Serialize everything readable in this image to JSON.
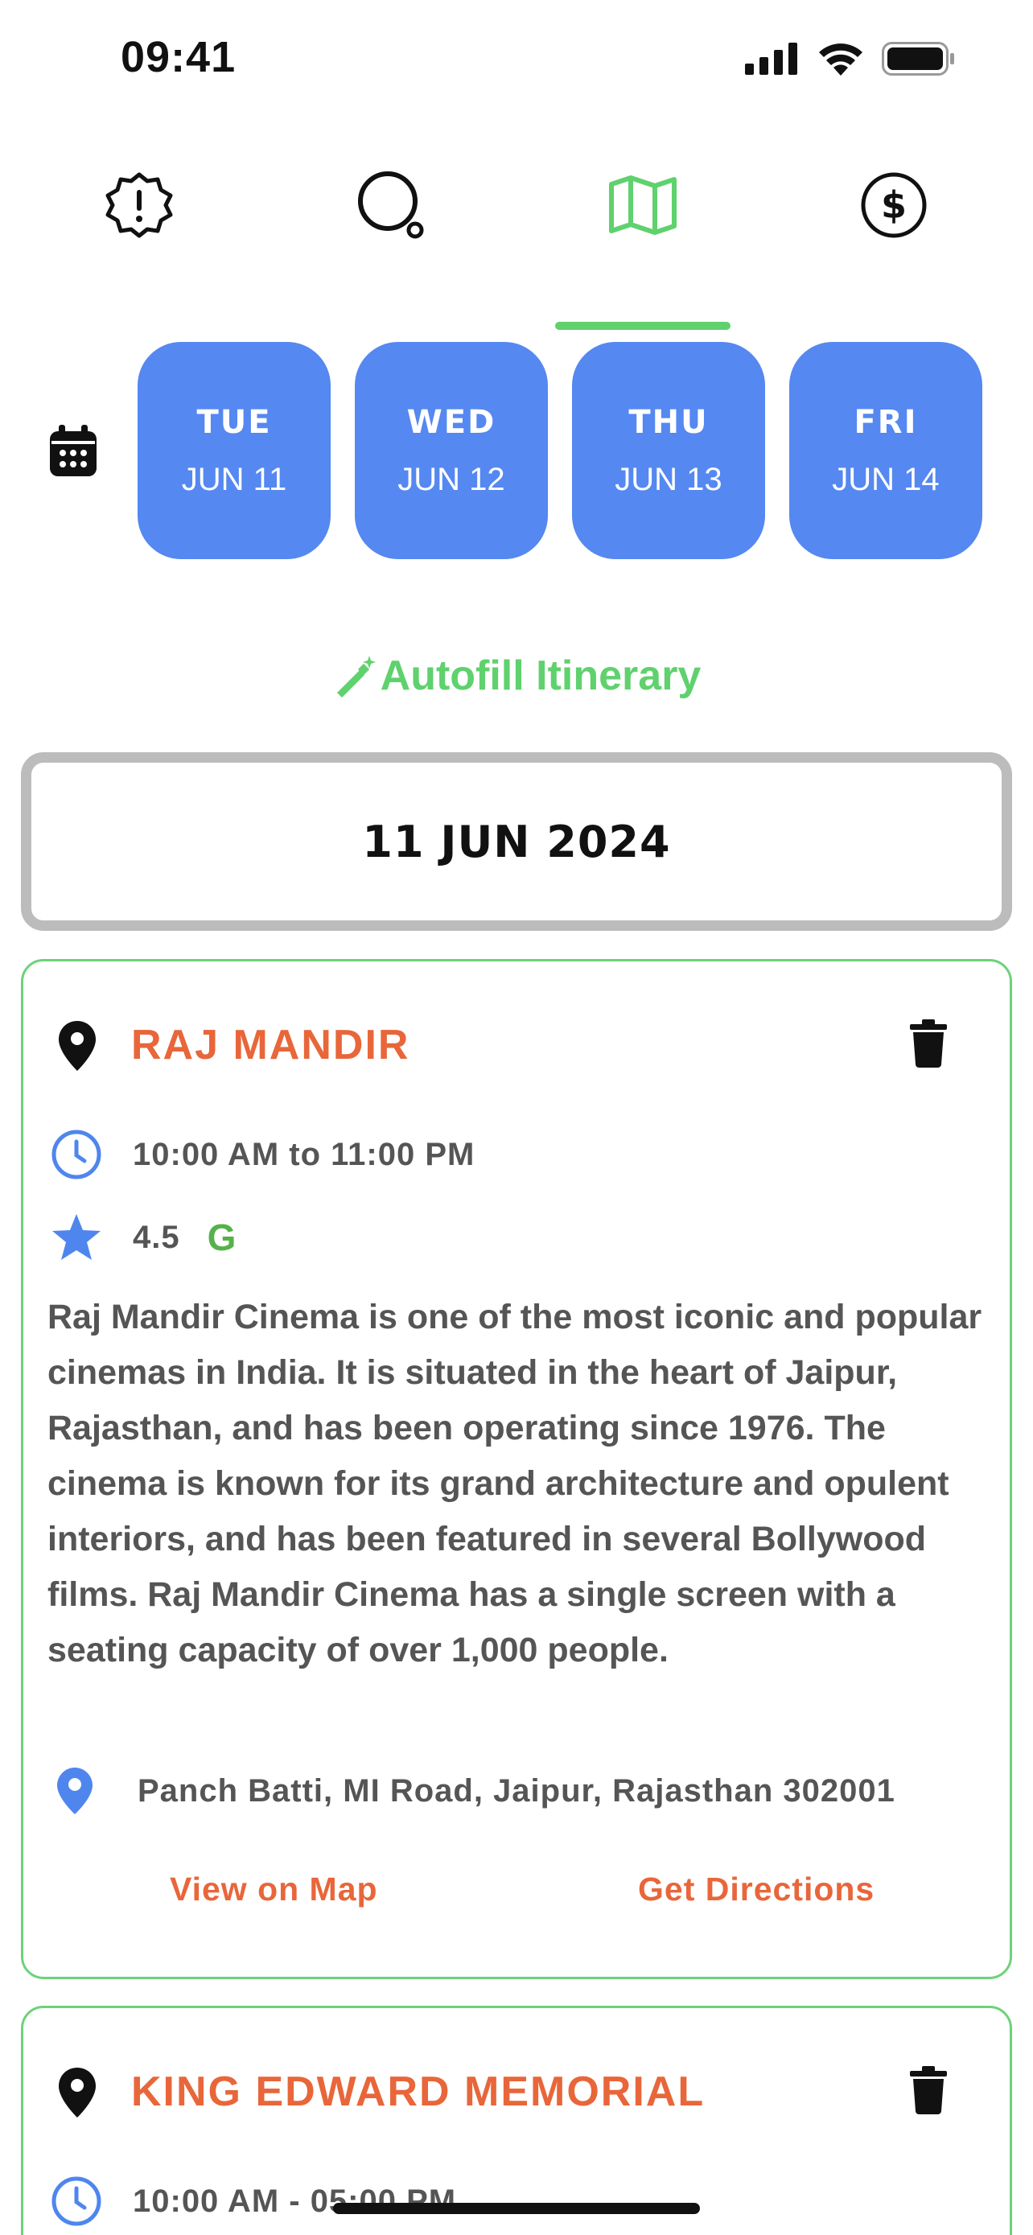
{
  "status": {
    "time": "09:41"
  },
  "tabs": [
    {
      "name": "alerts",
      "icon": "alert-badge-icon"
    },
    {
      "name": "search",
      "icon": "search-icon"
    },
    {
      "name": "map",
      "icon": "map-icon",
      "active": true
    },
    {
      "name": "budget",
      "icon": "dollar-icon"
    }
  ],
  "days": [
    {
      "dow": "TUE",
      "date": "JUN 11"
    },
    {
      "dow": "WED",
      "date": "JUN 12"
    },
    {
      "dow": "THU",
      "date": "JUN 13"
    },
    {
      "dow": "FRI",
      "date": "JUN 14"
    }
  ],
  "autofill_label": "Autofill Itinerary",
  "selected_date": "11 JUN 2024",
  "places": [
    {
      "name": "RAJ MANDIR",
      "hours": "10:00 AM to 11:00 PM",
      "rating": "4.5",
      "rating_source": "G",
      "description": "Raj Mandir Cinema is one of the most iconic and popular cinemas in India. It is situated in the heart of Jaipur, Rajasthan, and has been operating since 1976. The cinema is known for its grand architecture and opulent interiors, and has been featured in several Bollywood films. Raj Mandir Cinema has a single screen with a seating capacity of over 1,000 people.",
      "address": "Panch Batti, MI Road, Jaipur, Rajasthan 302001",
      "view_map": "View on Map",
      "directions": "Get Directions"
    },
    {
      "name": "KING EDWARD MEMORIAL",
      "hours": "10:00 AM - 05:00 PM"
    }
  ],
  "colors": {
    "accent_green": "#5fd16d",
    "day_blue": "#5588f0",
    "place_orange": "#e8663a",
    "icon_blue": "#4f86ee"
  }
}
